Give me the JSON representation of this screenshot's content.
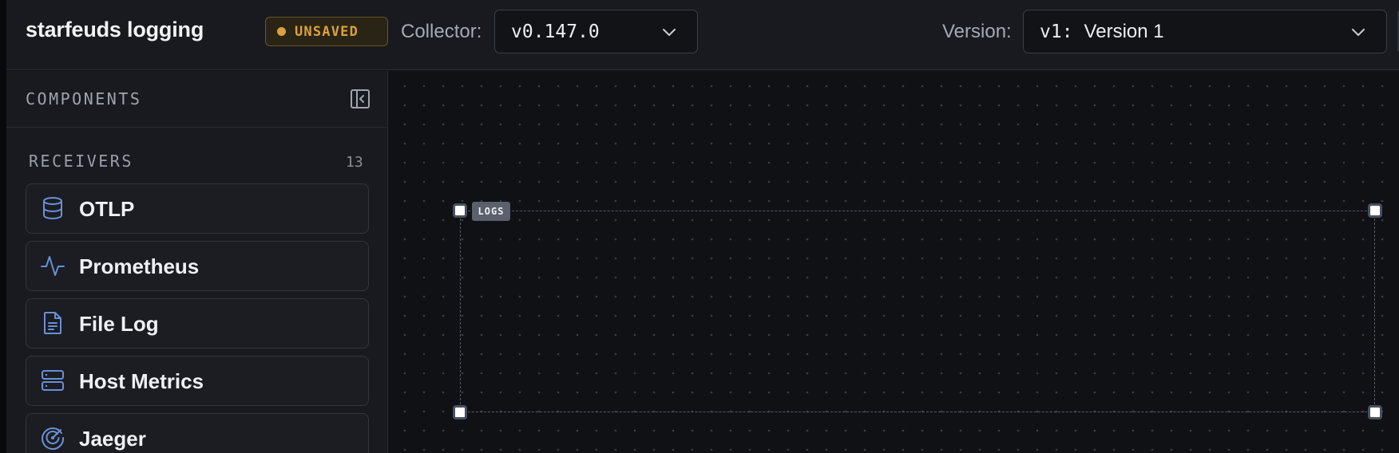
{
  "header": {
    "title": "starfeuds logging",
    "status_badge": "UNSAVED",
    "collector_label": "Collector:",
    "collector_value": "v0.147.0",
    "version_label": "Version:",
    "version_key": "v1:",
    "version_name": "Version 1"
  },
  "sidebar": {
    "title": "COMPONENTS",
    "section": {
      "title": "RECEIVERS",
      "count": "13",
      "items": [
        {
          "label": "OTLP",
          "icon": "database-icon"
        },
        {
          "label": "Prometheus",
          "icon": "activity-icon"
        },
        {
          "label": "File Log",
          "icon": "file-text-icon"
        },
        {
          "label": "Host Metrics",
          "icon": "server-icon"
        },
        {
          "label": "Jaeger",
          "icon": "radar-icon"
        }
      ]
    }
  },
  "canvas": {
    "group_tag": "LOGS"
  },
  "colors": {
    "accent_icon": "#6b8fd6",
    "badge_amber": "#d9a23b",
    "background": "#0f1115",
    "panel": "#181a1f"
  }
}
